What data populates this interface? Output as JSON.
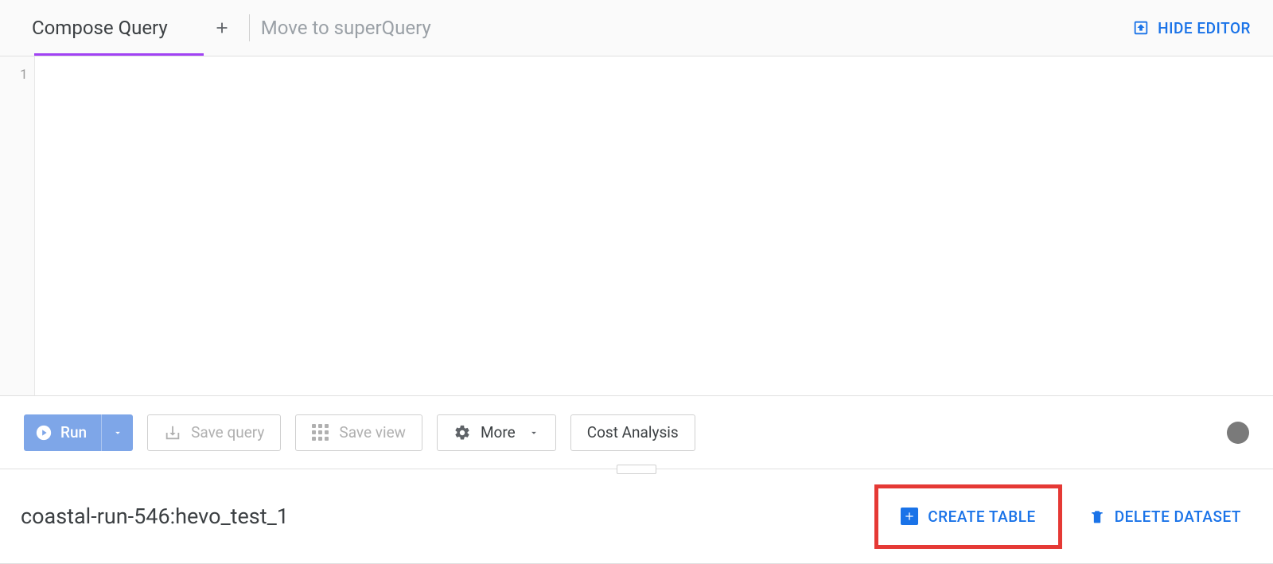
{
  "header": {
    "tab_label": "Compose Query",
    "superquery_label": "Move to superQuery",
    "hide_editor_label": "HIDE EDITOR"
  },
  "editor": {
    "line_number": "1"
  },
  "toolbar": {
    "run_label": "Run",
    "save_query_label": "Save query",
    "save_view_label": "Save view",
    "more_label": "More",
    "cost_analysis_label": "Cost Analysis"
  },
  "dataset": {
    "name": "coastal-run-546:hevo_test_1",
    "create_table_label": "CREATE TABLE",
    "delete_dataset_label": "DELETE DATASET"
  }
}
